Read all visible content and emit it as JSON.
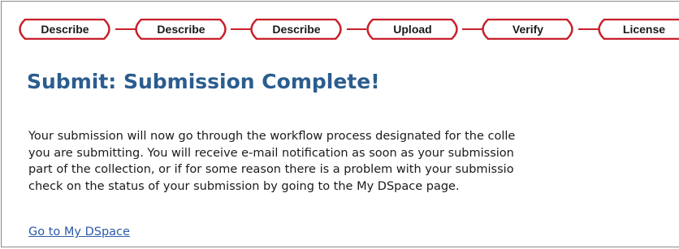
{
  "progress": {
    "steps": [
      {
        "label": "Describe"
      },
      {
        "label": "Describe"
      },
      {
        "label": "Describe"
      },
      {
        "label": "Upload"
      },
      {
        "label": "Verify"
      },
      {
        "label": "License"
      }
    ],
    "pill_border_color": "#c8202a"
  },
  "heading": "Submit: Submission Complete!",
  "body_lines": [
    "Your submission will now go through the workflow process designated for the colle",
    "you are submitting. You will receive e-mail notification as soon as your submission",
    "part of the collection, or if for some reason there is a problem with your submissio",
    "check on the status of your submission by going to the My DSpace page."
  ],
  "link_text": "Go to My DSpace",
  "colors": {
    "heading": "#2b5d8f",
    "link": "#2b5aa8",
    "text": "#1a1a1a"
  }
}
